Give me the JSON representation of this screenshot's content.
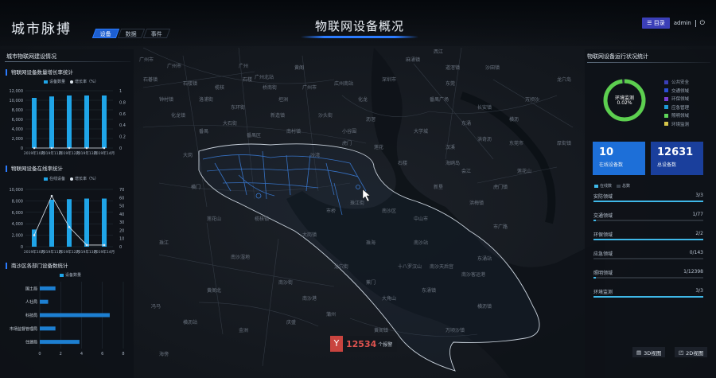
{
  "header": {
    "brand": "城市脉搏",
    "tabs": [
      {
        "label": "设备",
        "active": true
      },
      {
        "label": "数据",
        "active": false
      },
      {
        "label": "事件",
        "active": false
      }
    ],
    "title": "物联网设备概况",
    "directory_label": "目录",
    "user": "admin"
  },
  "map_labels": [
    "广州市",
    "广州市",
    "广州",
    "广州北站",
    "广州市",
    "広州南站",
    "番禺",
    "番禺区",
    "沥滘",
    "南沙区",
    "东涌",
    "洪奇沥",
    "横沥",
    "万顷沙",
    "龙穴岛",
    "虎门",
    "东莞",
    "长安镇",
    "深圳市",
    "珠海",
    "中山市",
    "黄阁",
    "大岗",
    "榄核",
    "坦洲",
    "横门",
    "沙湾",
    "市桥",
    "石楼",
    "莲花山",
    "海鸥岛",
    "新垦",
    "蕉门",
    "南沙港",
    "南沙湿地",
    "珠江",
    "西江",
    "沙田镇",
    "麻涌镇",
    "道滘镇",
    "东莞市",
    "洪梅镇",
    "厚街镇",
    "虎门镇",
    "南沙站",
    "黄阁镇",
    "万顷沙镇",
    "横沥镇",
    "东涌镇",
    "大岗镇",
    "榄核镇",
    "珠江街",
    "龙穴街",
    "南沙街",
    "莲花山",
    "化龙镇",
    "石碁镇",
    "石楼镇",
    "钟村镇",
    "大石街",
    "新造镇",
    "南村镇",
    "洛浦街",
    "东环街",
    "桥南街",
    "沙头街",
    "小谷围",
    "化龙",
    "莲花",
    "石楼",
    "大学城",
    "番禺广场",
    "汉溪",
    "会江",
    "市广路",
    "东涌站",
    "南沙客运港",
    "南沙天后宫",
    "十八罗汉山",
    "大角山",
    "蒲州",
    "庆盛",
    "金洲",
    "黄阁北",
    "横沥站",
    "冯马",
    "海傍"
  ],
  "left_panel": {
    "heading": "城市物联网建设情况",
    "growth": {
      "title": "物联网设备数量增长率统计",
      "legend": [
        "设备数量",
        "增长率（%）"
      ],
      "categories": [
        "2019年10月",
        "2019年11月",
        "2019年12月",
        "2019年13月",
        "2019年14月"
      ],
      "yticks_left": [
        "12,000",
        "10,000",
        "8,000",
        "6,000",
        "4,000",
        "2,000",
        "0"
      ],
      "yticks_right": [
        "1",
        "0.8",
        "0.6",
        "0.4",
        "0.2",
        "0"
      ],
      "values": [
        10500,
        10800,
        11000,
        11000,
        11000
      ],
      "rates": [
        0,
        0,
        0,
        0,
        0
      ]
    },
    "online": {
      "title": "物联网设备在线率统计",
      "legend": [
        "在线设备",
        "增长率（%）"
      ],
      "categories": [
        "2019年10月",
        "2019年11月",
        "2019年12月",
        "2019年13月",
        "2019年14月"
      ],
      "yticks_left": [
        "10,000",
        "8,000",
        "6,000",
        "4,000",
        "2,000",
        "0"
      ],
      "yticks_right": [
        "70",
        "60",
        "50",
        "40",
        "30",
        "20",
        "10",
        "0"
      ],
      "values": [
        3000,
        8200,
        8300,
        8400,
        8400
      ],
      "rates": [
        14,
        62,
        24,
        2,
        2
      ]
    },
    "departments": {
      "title": "南沙区各部门设备数统计",
      "legend": [
        "设备数量"
      ],
      "categories": [
        "国土局",
        "人社局",
        "科技局",
        "市场监督管理局",
        "住建局"
      ],
      "values": [
        1.5,
        0.8,
        6.7,
        1.5,
        3.8
      ],
      "xticks": [
        "0",
        "2",
        "4",
        "6",
        "8"
      ]
    }
  },
  "right_panel": {
    "heading": "物联网设备运行状况统计",
    "ring": {
      "label": "环境监测",
      "percent": "0.02%",
      "value_fraction": 0.98
    },
    "ring_legend": [
      {
        "label": "公共安全",
        "color": "#3b3fb8"
      },
      {
        "label": "交通领域",
        "color": "#2b4ed6"
      },
      {
        "label": "环保领域",
        "color": "#7b3fd6"
      },
      {
        "label": "应急管理",
        "color": "#1d9bd6"
      },
      {
        "label": "照明领域",
        "color": "#5fd65a"
      },
      {
        "label": "环境监测",
        "color": "#d6c64a"
      }
    ],
    "stats": [
      {
        "value": "10",
        "label": "在线设备数"
      },
      {
        "value": "12631",
        "label": "总设备数"
      }
    ],
    "legend": [
      "在线数",
      "总数"
    ],
    "domains": [
      {
        "name": "安防领域",
        "count": "3/3",
        "fill": 1.0
      },
      {
        "name": "交通领域",
        "count": "1/77",
        "fill": 0.013
      },
      {
        "name": "环保领域",
        "count": "2/2",
        "fill": 1.0
      },
      {
        "name": "应急领域",
        "count": "0/143",
        "fill": 0.0
      },
      {
        "name": "照明领域",
        "count": "1/12398",
        "fill": 0.0001
      },
      {
        "name": "环境监测",
        "count": "3/3",
        "fill": 1.0
      }
    ]
  },
  "bottom": {
    "count": "12534",
    "count_unit": "个报警",
    "btn_3d": "3D视图",
    "btn_2d": "2D视图"
  },
  "colors": {
    "accent": "#2b7bff",
    "bar": "#1fa5e8",
    "ring": "#5ccf4f",
    "stat_box": "#1d6fd8"
  }
}
